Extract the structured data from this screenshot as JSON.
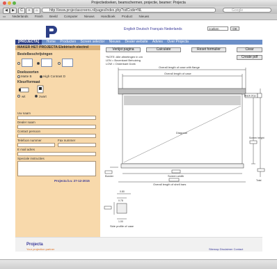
{
  "browser": {
    "window_title": "Projectiedoeken, beamschermen, projectie, beamer: Projecta",
    "url": "http://www.projectascreens.nl/pages/index.php?odCode=NL",
    "search_placeholder": "Google",
    "nav_back": "◀",
    "nav_forward": "▶",
    "reload": "C",
    "add": "+",
    "home": "⌂",
    "bookmarks": [
      "Nederlands",
      "Finish",
      "Beeld",
      "Computer",
      "Nieuws",
      "Handboek",
      "Product",
      "Nieuws"
    ]
  },
  "header": {
    "lang_links": "English Deutsch Français Nederlands",
    "search_value": "zoeken",
    "ok_label": "OK",
    "brand": "[PROJECTA]",
    "nav_items": [
      "Home",
      "Producten",
      "Screen selector",
      "Nieuws",
      "Dealer website",
      "Advies",
      "Over Projecta"
    ]
  },
  "left": {
    "header": "MAKER HET PROJECTA Elektrisch electrol",
    "section_behuizing": "Bestelbeschrijvingen",
    "section_doek": "Doeksoorten",
    "doek_options": [
      "Matte B",
      "High Contrast D"
    ],
    "section_kleur": "Kleur/formaat",
    "kleur_options": [
      "wit",
      "zwart"
    ],
    "fields": {
      "bedrijf": "Uw naam",
      "naam": "Dealer naam",
      "contact": "Contact persoon",
      "telefoon": "Telefoon nummer",
      "fax": "Fax nummer",
      "email": "E mail adres",
      "opmerkingen": "Speciale instructies"
    },
    "footer_text": "Projecta b.v. 27-12-2015"
  },
  "buttons": {
    "verlopen": "Verlijst pagina",
    "calculate": "Calculate",
    "reset": "Reset formulier",
    "clear": "Clear",
    "create_pdf": "Create pdf"
  },
  "notes": [
    "*NOTE: Alle afmetingen in cm",
    "LEN = Bovenkant Behuizing",
    "LOW = Onderkant Doek"
  ],
  "drawing": {
    "overall_length": "Overall length of case with flange",
    "case_length": "Overall length of case",
    "drop_label": "Black drop",
    "diagonal": "Diagonal",
    "screen_height": "Screen height",
    "screen_width": "Screen width",
    "overall_width": "Overall length of shell bars",
    "border": "Border",
    "total": "Total",
    "slide_profile": "Side profile of case",
    "dim_a": "0.80",
    "dim_b": "0.78",
    "dim_c": "1.00"
  },
  "footer": {
    "logo": "Projecta",
    "slogan": "Your projection partner",
    "links": "Sitemap Disclaimer Contact"
  }
}
